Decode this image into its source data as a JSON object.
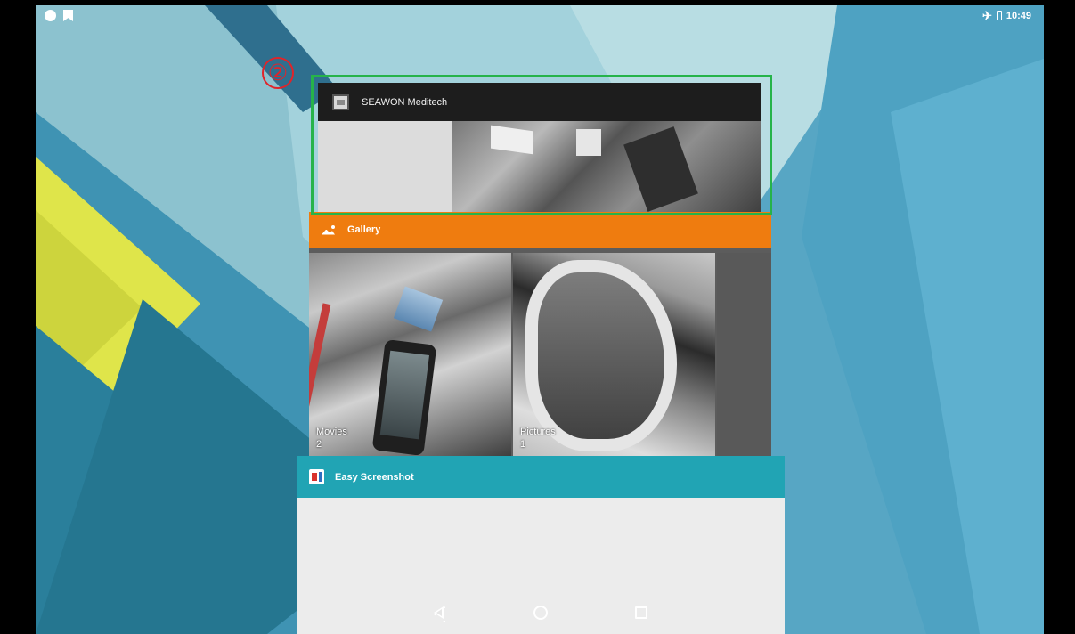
{
  "status_bar": {
    "time": "10:49",
    "left_icons": [
      "circle-notification-icon",
      "bookmark-notification-icon"
    ],
    "right_icons": [
      "airplane-mode-icon",
      "battery-icon"
    ]
  },
  "annotation": {
    "step_marker": "②",
    "highlight_color": "#26b34a",
    "marker_color": "#e0242a"
  },
  "recent_apps": [
    {
      "title": "SEAWON Meditech",
      "header_color": "#1d1d1d",
      "icon": "seawon-app-icon"
    },
    {
      "title": "Gallery",
      "header_color": "#ef7c0f",
      "icon": "gallery-app-icon",
      "albums": [
        {
          "name": "Movies",
          "count": "2"
        },
        {
          "name": "Pictures",
          "count": "1"
        }
      ]
    },
    {
      "title": "Easy Screenshot",
      "header_color": "#21a4b4",
      "icon": "easy-screenshot-app-icon"
    }
  ],
  "nav_bar": {
    "buttons": [
      "back-icon",
      "home-icon",
      "recents-icon"
    ]
  },
  "wallpaper": {
    "colors": [
      "#5aa7c3",
      "#9ccbd6",
      "#2b7f99",
      "#e0e84a"
    ]
  }
}
